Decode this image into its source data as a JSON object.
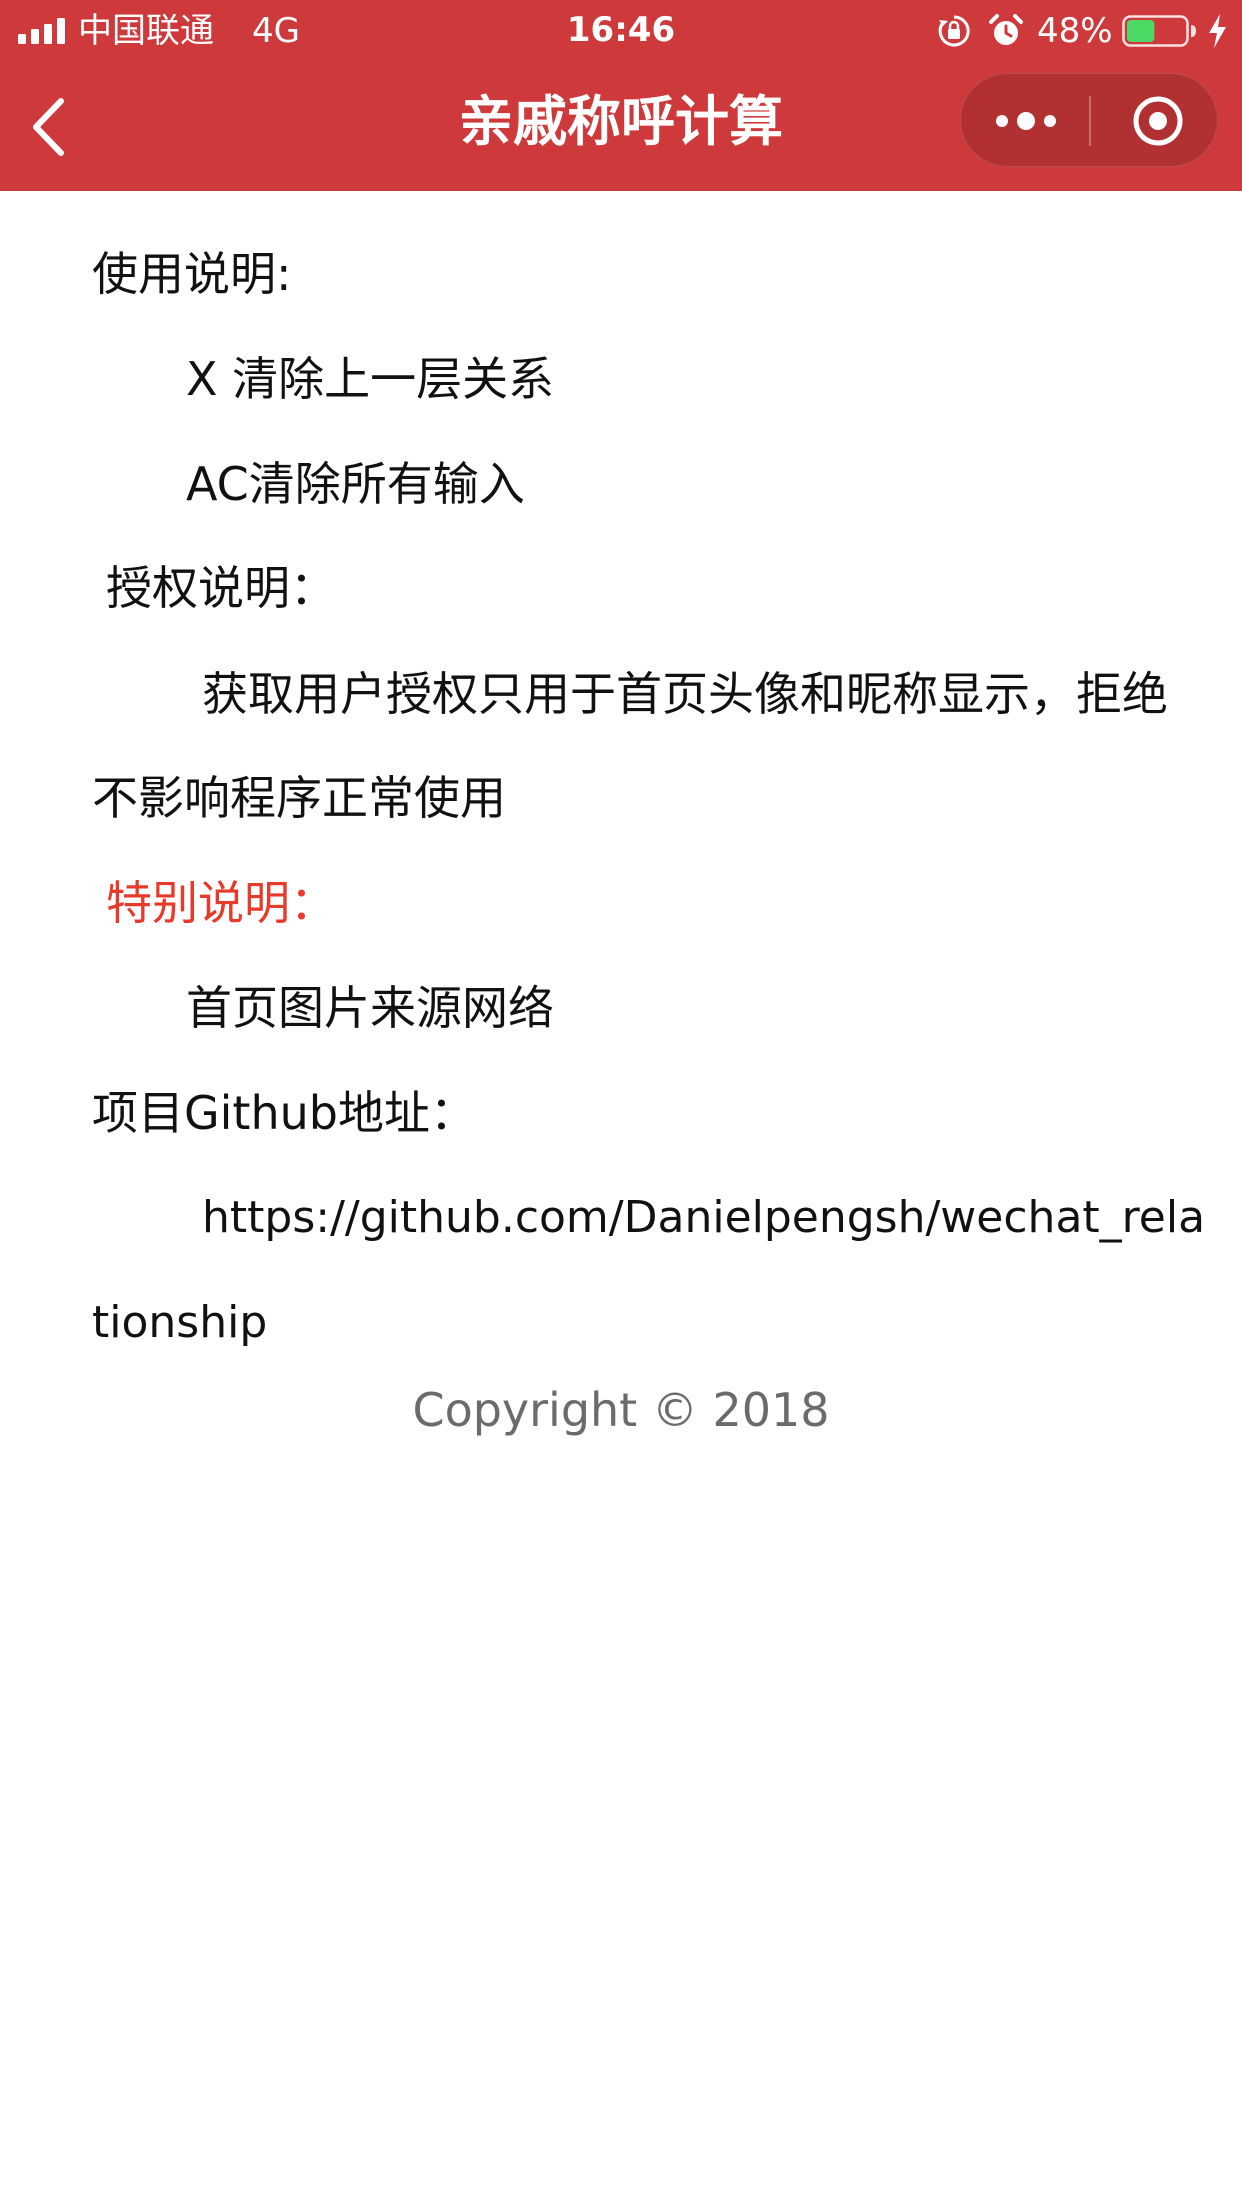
{
  "status_bar": {
    "carrier": "中国联通",
    "network": "4G",
    "time": "16:46",
    "battery_percent": "48%",
    "battery_level": 0.48,
    "battery_color": "#4cd964",
    "icons": [
      "signal-icon",
      "rotation-lock-icon",
      "alarm-icon",
      "battery-icon",
      "charging-icon"
    ]
  },
  "nav": {
    "title": "亲戚称呼计算",
    "background": "#ce3a3c",
    "back_icon": "chevron-left-icon",
    "menu_icon": "more-dots-icon",
    "close_icon": "target-icon"
  },
  "content": {
    "usage_title": "使用说明:",
    "usage_x": "X 清除上一层关系",
    "usage_ac": "AC清除所有输入",
    "auth_title": "授权说明：",
    "auth_text_line1": "获取用户授权只用于首页头像和昵称显示，拒绝",
    "auth_text_line2": "不影响程序正常使用",
    "special_title": "特别说明：",
    "special_color": "#e83a2a",
    "special_text": "首页图片来源网络",
    "github_title": "项目Github地址：",
    "github_url_line1": "https://github.com/Danielpengsh/wechat_rela",
    "github_url_line2": "tionship",
    "copyright": "Copyright © 2018"
  }
}
